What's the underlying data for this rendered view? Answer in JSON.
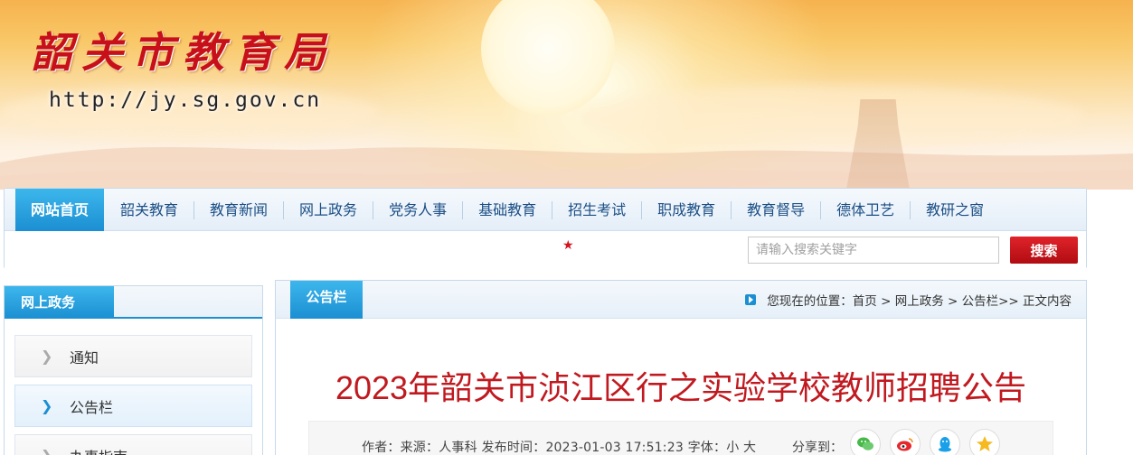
{
  "header": {
    "site_title": "韶关市教育局",
    "site_url": "http://jy.sg.gov.cn"
  },
  "nav": {
    "items": [
      {
        "label": "网站首页",
        "active": true
      },
      {
        "label": "韶关教育"
      },
      {
        "label": "教育新闻"
      },
      {
        "label": "网上政务"
      },
      {
        "label": "党务人事"
      },
      {
        "label": "基础教育"
      },
      {
        "label": "招生考试"
      },
      {
        "label": "职成教育"
      },
      {
        "label": "教育督导"
      },
      {
        "label": "德体卫艺"
      },
      {
        "label": "教研之窗"
      }
    ]
  },
  "search": {
    "placeholder": "请输入搜索关键字",
    "button_label": "搜索"
  },
  "sidebar": {
    "title": "网上政务",
    "items": [
      {
        "label": "通知"
      },
      {
        "label": "公告栏",
        "active": true
      },
      {
        "label": "办事指南"
      }
    ]
  },
  "main": {
    "tab_label": "公告栏",
    "breadcrumb": "您现在的位置：首页 > 网上政务 > 公告栏>> 正文内容",
    "article_title": "2023年韶关市浈江区行之实验学校教师招聘公告",
    "meta": {
      "text": "作者：来源：人事科    发布时间：2023-01-03 17:51:23    字体：小  大",
      "share_label": "分享到："
    },
    "share_icons": [
      "wechat-icon",
      "weibo-icon",
      "qq-icon",
      "qzone-icon"
    ]
  },
  "colors": {
    "nav_active": "#1b8fd2",
    "title_red": "#c0191f",
    "logo_red": "#c8101a",
    "search_btn": "#c4151c"
  }
}
